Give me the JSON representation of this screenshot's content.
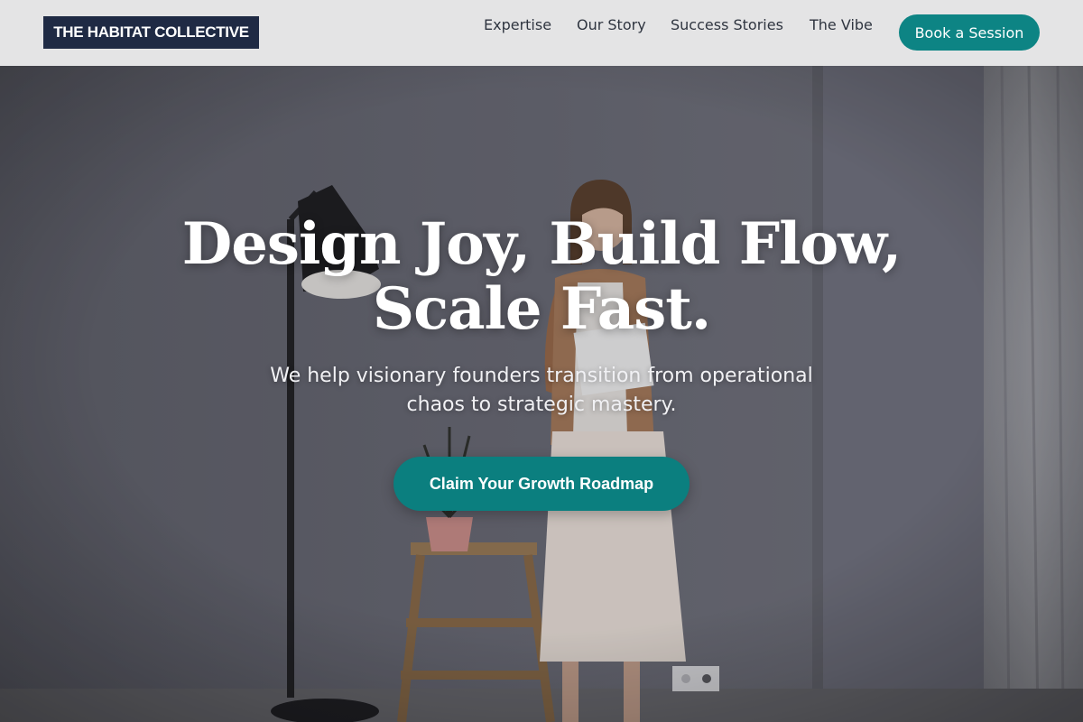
{
  "header": {
    "logo_text": "THE HABITAT COLLECTIVE",
    "nav": [
      {
        "label": "Expertise"
      },
      {
        "label": "Our Story"
      },
      {
        "label": "Success Stories"
      },
      {
        "label": "The Vibe"
      }
    ],
    "cta_label": "Book a Session"
  },
  "hero": {
    "headline_line1": "Design Joy, Build Flow,",
    "headline_line2": "Scale Fast.",
    "subtext_line1": "We help visionary founders transition from operational",
    "subtext_line2": "chaos to strategic mastery.",
    "cta_label": "Claim Your Growth Roadmap",
    "background_image": "woman-in-studio-photo"
  },
  "colors": {
    "brand_dark": "#1f2a44",
    "accent_teal": "#0d8484",
    "header_bg": "#e4e4e5"
  }
}
